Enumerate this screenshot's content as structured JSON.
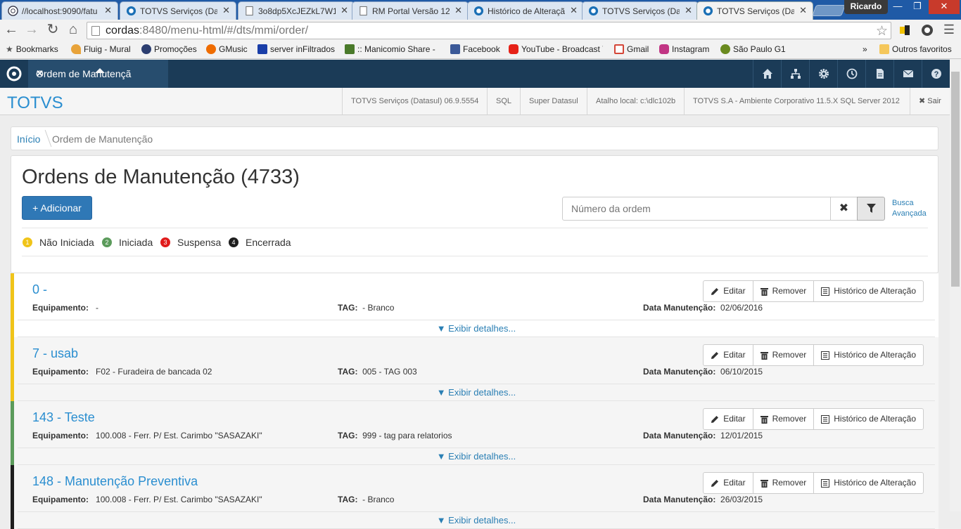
{
  "browser": {
    "tabs": [
      {
        "title": "//localhost:9090/fatu",
        "icon": "globe-icon"
      },
      {
        "title": "TOTVS Serviços (Data",
        "icon": "totvs-icon"
      },
      {
        "title": "3o8dp5XcJEZkL7W1",
        "icon": "page-icon"
      },
      {
        "title": "RM Portal Versão 12",
        "icon": "page-icon"
      },
      {
        "title": "Histórico de Alteraçã",
        "icon": "totvs-icon"
      },
      {
        "title": "TOTVS Serviços (Data",
        "icon": "totvs-icon"
      },
      {
        "title": "TOTVS Serviços (Data",
        "icon": "totvs-icon",
        "active": true
      }
    ],
    "profile": "Ricardo",
    "url_host": "cordas",
    "url_rest": ":8480/menu-html/#/dts/mmi/order/",
    "bookmarks": [
      {
        "label": "Bookmarks",
        "color": "#555555"
      },
      {
        "label": "Fluig - Mural",
        "color": "#e8a33a"
      },
      {
        "label": "Promoções",
        "color": "#2c3e70"
      },
      {
        "label": "GMusic",
        "color": "#ef6c00"
      },
      {
        "label": "server inFiltrados",
        "color": "#1a3ea8"
      },
      {
        "label": ":: Manicomio Share - /",
        "color": "#4a7a2a"
      },
      {
        "label": "Facebook",
        "color": "#3b5998"
      },
      {
        "label": "YouTube - Broadcast Y",
        "color": "#e62117"
      },
      {
        "label": "Gmail",
        "color": "#d44638"
      },
      {
        "label": "Instagram",
        "color": "#c13584"
      },
      {
        "label": "São Paulo G1",
        "color": "#6a8a1f"
      }
    ],
    "bookmarks_more": "»",
    "other_bookmarks": "Outros favoritos"
  },
  "app": {
    "tab_label": "Ordem de Manutençã",
    "brand": "TOTVS",
    "info": [
      "TOTVS Serviços (Datasul) 06.9.5554",
      "SQL",
      "Super Datasul",
      "Atalho local: c:\\dlc102b",
      "TOTVS S.A - Ambiente Corporativo 11.5.X SQL Server 2012"
    ],
    "logout": "✖ Sair",
    "header_icons": [
      "home-icon",
      "sitemap-icon",
      "gear-icon",
      "clock-icon",
      "document-icon",
      "mail-icon",
      "help-icon"
    ]
  },
  "breadcrumb": {
    "home": "Início",
    "current": "Ordem de Manutenção"
  },
  "page": {
    "title": "Ordens de Manutenção (4733)",
    "add_label": "+ Adicionar",
    "search_placeholder": "Número da ordem",
    "clear": "✖",
    "advanced_line1": "Busca",
    "advanced_line2": "Avançada"
  },
  "legend": [
    {
      "num": "1",
      "label": "Não Iniciada",
      "color": "#f0c419"
    },
    {
      "num": "2",
      "label": "Iniciada",
      "color": "#5b9b5b"
    },
    {
      "num": "3",
      "label": "Suspensa",
      "color": "#e01b1b"
    },
    {
      "num": "4",
      "label": "Encerrada",
      "color": "#1e1e1e"
    }
  ],
  "orders": [
    {
      "title": "0 -",
      "status_color": "#f0c419",
      "equipment": "-",
      "tag": "- Branco",
      "date": "02/06/2016"
    },
    {
      "title": "7 - usab",
      "status_color": "#f0c419",
      "equipment": "F02 - Furadeira de bancada 02",
      "tag": "005 - TAG 003",
      "date": "06/10/2015"
    },
    {
      "title": "143 - Teste",
      "status_color": "#5b9b5b",
      "equipment": "100.008 - Ferr. P/ Est. Carimbo \"SASAZAKI\"",
      "tag": "999 - tag para relatorios",
      "date": "12/01/2015"
    },
    {
      "title": "148 - Manutenção Preventiva",
      "status_color": "#1e1e1e",
      "equipment": "100.008 - Ferr. P/ Est. Carimbo \"SASAZAKI\"",
      "tag": "- Branco",
      "date": "26/03/2015"
    }
  ],
  "order_labels": {
    "equipment": "Equipamento:",
    "tag": "TAG:",
    "date": "Data Manutenção:",
    "edit": "Editar",
    "remove": "Remover",
    "history": "Histórico de Alteração",
    "details": "▼ Exibir detalhes..."
  }
}
